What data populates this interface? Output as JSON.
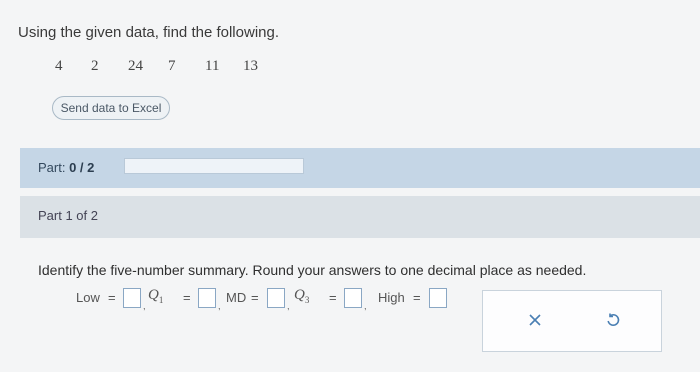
{
  "prompt": "Using the given data, find the following.",
  "data_values": [
    "4",
    "2",
    "24",
    "7",
    "11",
    "13"
  ],
  "excel_button": "Send data to Excel",
  "part": {
    "label": "Part:",
    "progress": "0 / 2",
    "of": "Part 1 of 2"
  },
  "question": "Identify the five-number summary. Round your answers to one decimal place as needed.",
  "answers": {
    "low_label": "Low",
    "eq": "=",
    "q1_label": "Q",
    "q1_sub": "1",
    "md_label": "MD",
    "q3_label": "Q",
    "q3_sub": "3",
    "high_label": "High",
    "comma": ","
  },
  "colors": {
    "part_bar": "#c5d6e6",
    "part_of_bar": "#dbe1e6",
    "accent": "#4a7fb3"
  },
  "icons": {
    "clear": "x-icon",
    "undo": "undo-icon"
  }
}
